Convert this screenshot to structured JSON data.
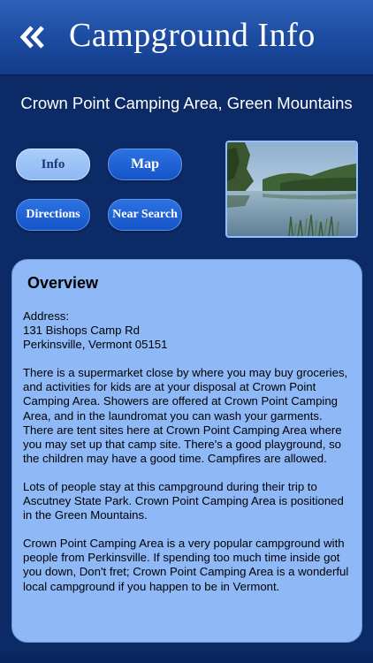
{
  "header": {
    "title": "Campground Info",
    "back_icon": "double-chevron-left-icon"
  },
  "campground": {
    "name": "Crown Point Camping Area, Green Mountains"
  },
  "buttons": {
    "info": "Info",
    "map": "Map",
    "directions": "Directions",
    "near_search": "Near Search"
  },
  "photo": {
    "icon": "lake-photo"
  },
  "overview": {
    "title": "Overview",
    "address_label": "Address:",
    "address_street": "131 Bishops Camp Rd",
    "address_city": "Perkinsville, Vermont 05151",
    "paragraph1": "There is a supermarket close by where you may buy groceries, and activities for kids are at your disposal at Crown Point Camping Area. Showers are offered at Crown Point Camping Area, and in the laundromat you can wash your garments. There are tent sites here at Crown Point Camping Area where you may set up that camp site. There's a good playground, so the children may have a good time. Campfires are allowed.",
    "paragraph2": "Lots of people stay at this campground during their trip to Ascutney State Park. Crown Point Camping Area is positioned in the Green Mountains.",
    "paragraph3": "Crown Point Camping Area is a very popular campground with people from Perkinsville. If spending too much time inside got you down, Don't fret; Crown Point Camping Area is a wonderful local campground if you happen to be in Vermont."
  },
  "colors": {
    "background": "#0b2a66",
    "header": "#1b4a9f",
    "panel": "#8fb8f6",
    "button_light": "#8db9f3",
    "button_dark": "#1554c7"
  }
}
